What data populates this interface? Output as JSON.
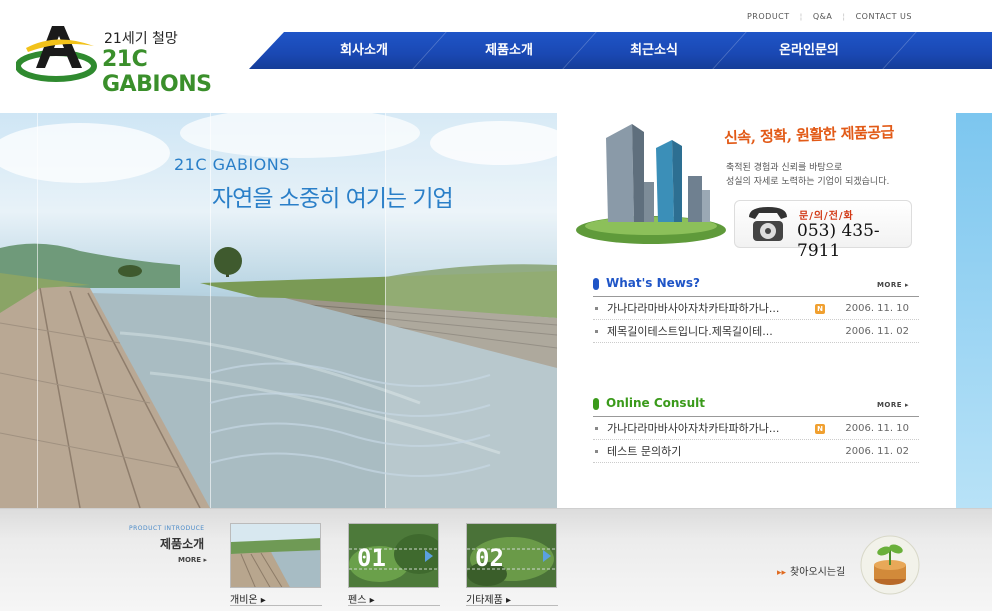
{
  "util_links": [
    "PRODUCT",
    "Q&A",
    "CONTACT US"
  ],
  "logo": {
    "tagline": "21세기 철망",
    "brand": "21C GABIONS"
  },
  "nav": [
    "회사소개",
    "제품소개",
    "최근소식",
    "온라인문의"
  ],
  "hero": {
    "title": "21C GABIONS",
    "slogan": "자연을 소중히 여기는 기업"
  },
  "promo": {
    "headline": "신속, 정확, 원활한 제품공급",
    "desc_line1": "축적된 경험과 신뢰를 바탕으로",
    "desc_line2": "성실의 자세로 노력하는 기업이 되겠습니다.",
    "phone_label": "문/의/전/화",
    "phone_number": "053) 435-7911"
  },
  "news": {
    "title": "What's News?",
    "more": "MORE",
    "color": "#1f55c7",
    "items": [
      {
        "text": "가나다라마바사아자차카타파하가나...",
        "date": "2006. 11. 10",
        "new": true
      },
      {
        "text": "제목길이테스트입니다.제목길이테...",
        "date": "2006. 11. 02",
        "new": false
      }
    ]
  },
  "consult": {
    "title": "Online Consult",
    "more": "MORE",
    "color": "#3a9a1a",
    "items": [
      {
        "text": "가나다라마바사아자차카타파하가나...",
        "date": "2006. 11. 10",
        "new": true
      },
      {
        "text": "테스트 문의하기",
        "date": "2006. 11. 02",
        "new": false
      }
    ]
  },
  "bottom": {
    "small_title": "PRODUCT INTRODUCE",
    "title": "제품소개",
    "more": "MORE",
    "products": [
      {
        "label": "개비온"
      },
      {
        "label": "펜스",
        "badge": "01"
      },
      {
        "label": "기타제품",
        "badge": "02"
      }
    ],
    "find": "찾아오시는길"
  }
}
